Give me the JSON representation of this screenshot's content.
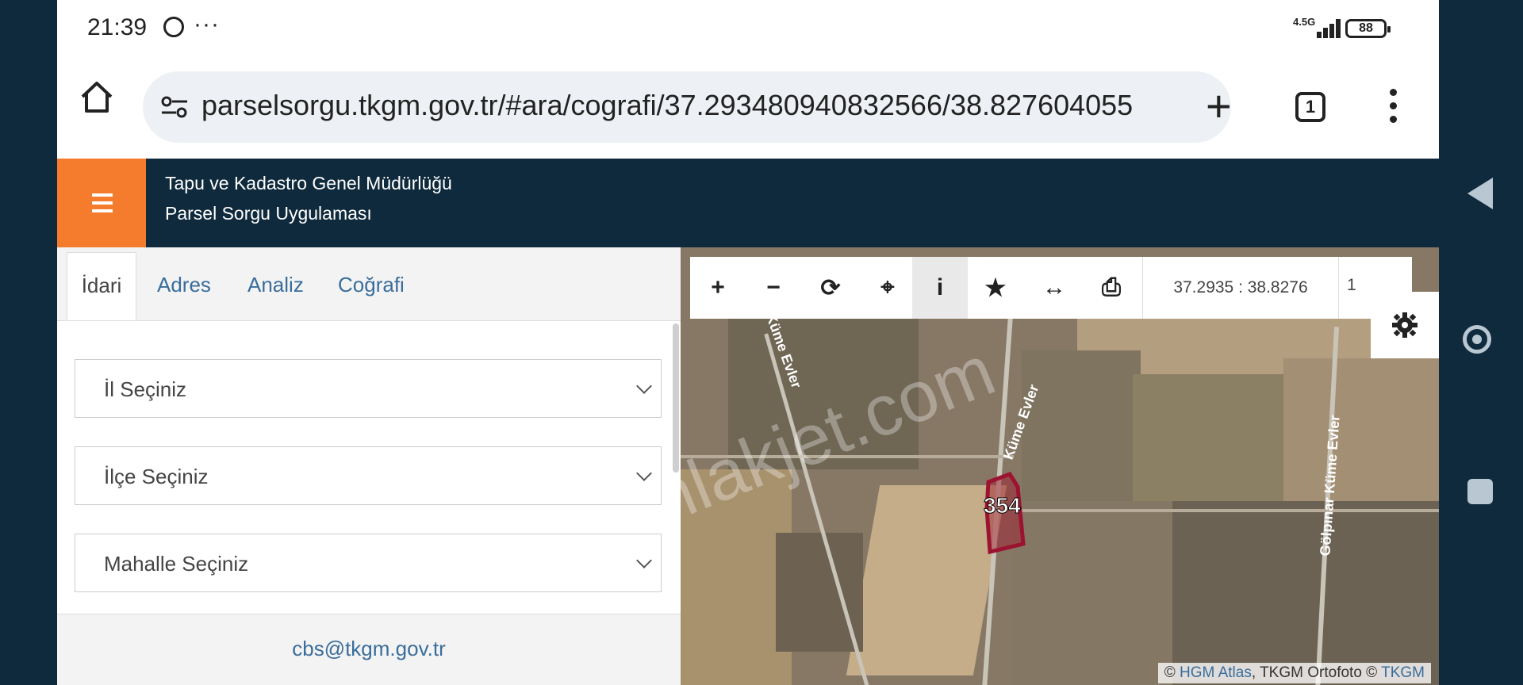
{
  "status_bar": {
    "time": "21:39",
    "more": "···",
    "network": "4.5G",
    "battery": "88"
  },
  "browser": {
    "url": "parselsorgu.tkgm.gov.tr/#ara/cografi/37.293480940832566/38.827604055",
    "tab_count": "1"
  },
  "app": {
    "org_title": "Tapu ve Kadastro Genel Müdürlüğü",
    "app_subtitle": "Parsel Sorgu Uygulaması",
    "accent_color": "#f57c2c",
    "header_color": "#0f2a3c"
  },
  "sidepanel": {
    "tabs": [
      {
        "label": "İdari",
        "active": true
      },
      {
        "label": "Adres",
        "active": false
      },
      {
        "label": "Analiz",
        "active": false
      },
      {
        "label": "Coğrafi",
        "active": false
      }
    ],
    "selects": [
      {
        "label": "İl Seçiniz"
      },
      {
        "label": "İlçe Seçiniz"
      },
      {
        "label": "Mahalle Seçiniz"
      }
    ],
    "contact_email": "cbs@tkgm.gov.tr"
  },
  "map": {
    "toolbar": {
      "icons": [
        "zoom-in-icon",
        "zoom-out-icon",
        "refresh-icon",
        "locate-icon",
        "info-icon",
        "star-icon",
        "measure-icon",
        "print-icon"
      ],
      "coordinates": "37.2935 : 38.8276",
      "scale": "1"
    },
    "parcel_number": "354",
    "road_labels": [
      "Küme Evler",
      "Küme Evler",
      "Gölpınar Küme Evler"
    ],
    "attribution": {
      "copy1": "©",
      "link1": "HGM Atlas",
      "middle": ", TKGM Ortofoto ©",
      "link2": "TKGM"
    },
    "watermark": "emlakjet.com"
  }
}
